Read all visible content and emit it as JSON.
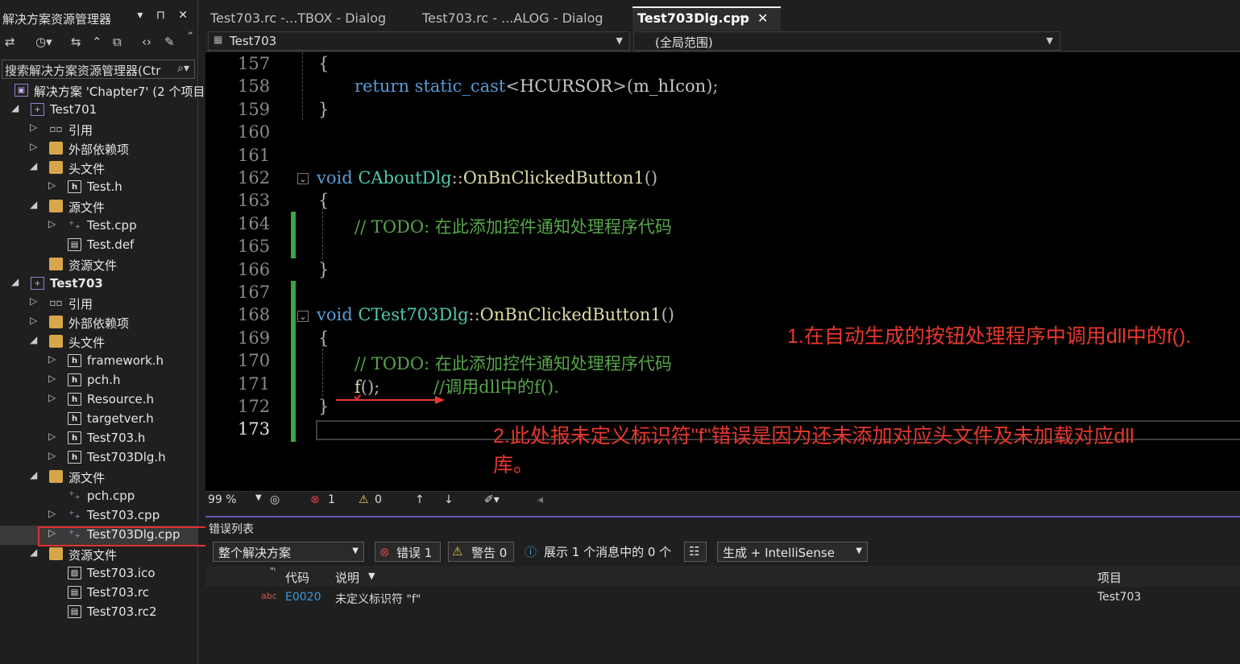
{
  "solution_explorer": {
    "title": "解决方案资源管理器",
    "title_controls": "▾ ⊓ ✕",
    "search_placeholder": "搜索解决方案资源管理器(Ctr",
    "tree": [
      {
        "name": "solution",
        "label": "解决方案 'Chapter7' (2 个项目",
        "icon": "solution-icon",
        "arrow": ""
      },
      {
        "name": "project-test701",
        "label": "Test701",
        "icon": "project-icon",
        "arrow": "◢"
      },
      {
        "name": "folder-references",
        "label": "引用",
        "icon": "references-icon",
        "arrow": "▷"
      },
      {
        "name": "folder-external",
        "label": "外部依赖项",
        "icon": "folder-icon",
        "arrow": "▷"
      },
      {
        "name": "folder-headers",
        "label": "头文件",
        "icon": "folder-icon",
        "arrow": "◢"
      },
      {
        "name": "file",
        "label": "Test.h",
        "icon": "header-file-icon",
        "arrow": "▷"
      },
      {
        "name": "folder-sources",
        "label": "源文件",
        "icon": "folder-icon",
        "arrow": "◢"
      },
      {
        "name": "file",
        "label": "Test.cpp",
        "icon": "cpp-file-icon",
        "arrow": "▷"
      },
      {
        "name": "file",
        "label": "Test.def",
        "icon": "def-file-icon",
        "arrow": ""
      },
      {
        "name": "folder-resources",
        "label": "资源文件",
        "icon": "folder-icon",
        "arrow": ""
      },
      {
        "name": "project-test703",
        "label": "Test703",
        "icon": "project-icon",
        "arrow": "◢",
        "bold": true
      },
      {
        "name": "folder-references",
        "label": "引用",
        "icon": "references-icon",
        "arrow": "▷"
      },
      {
        "name": "folder-external",
        "label": "外部依赖项",
        "icon": "folder-icon",
        "arrow": "▷"
      },
      {
        "name": "folder-headers",
        "label": "头文件",
        "icon": "folder-icon",
        "arrow": "◢"
      },
      {
        "name": "file",
        "label": "framework.h",
        "icon": "header-file-icon",
        "arrow": "▷"
      },
      {
        "name": "file",
        "label": "pch.h",
        "icon": "header-file-icon",
        "arrow": "▷"
      },
      {
        "name": "file",
        "label": "Resource.h",
        "icon": "header-file-icon",
        "arrow": "▷"
      },
      {
        "name": "file",
        "label": "targetver.h",
        "icon": "header-file-icon",
        "arrow": ""
      },
      {
        "name": "file",
        "label": "Test703.h",
        "icon": "header-file-icon",
        "arrow": "▷"
      },
      {
        "name": "file",
        "label": "Test703Dlg.h",
        "icon": "header-file-icon",
        "arrow": "▷"
      },
      {
        "name": "folder-sources",
        "label": "源文件",
        "icon": "folder-icon",
        "arrow": "◢"
      },
      {
        "name": "file",
        "label": "pch.cpp",
        "icon": "cpp-file-icon",
        "arrow": ""
      },
      {
        "name": "file",
        "label": "Test703.cpp",
        "icon": "cpp-file-icon",
        "arrow": "▷"
      },
      {
        "name": "file-selected",
        "label": "Test703Dlg.cpp",
        "icon": "cpp-file-icon",
        "arrow": "▷"
      },
      {
        "name": "folder-resources",
        "label": "资源文件",
        "icon": "folder-icon",
        "arrow": "◢"
      },
      {
        "name": "file",
        "label": "Test703.ico",
        "icon": "image-file-icon",
        "arrow": ""
      },
      {
        "name": "file",
        "label": "Test703.rc",
        "icon": "rc-file-icon",
        "arrow": ""
      },
      {
        "name": "file",
        "label": "Test703.rc2",
        "icon": "rc-file-icon",
        "arrow": ""
      }
    ]
  },
  "tabs": [
    {
      "label": "Test703.rc -...TBOX - Dialog"
    },
    {
      "label": "Test703.rc - ...ALOG - Dialog"
    },
    {
      "label": "Test703Dlg.cpp",
      "pin": "⊸",
      "close": "✕"
    }
  ],
  "nav": {
    "project": "Test703",
    "scope": "(全局范围)"
  },
  "editor": {
    "lines": [
      {
        "n": "157",
        "t": [
          [
            "pu",
            "{"
          ]
        ]
      },
      {
        "n": "158",
        "t": [
          [
            "kw",
            "return "
          ],
          [
            "kw",
            "static_cast"
          ],
          [
            "pu",
            "<"
          ],
          [
            "mac",
            "HCURSOR"
          ],
          [
            "pu",
            ">("
          ],
          [
            "mac",
            "m_hIcon"
          ],
          [
            "pu",
            ");"
          ]
        ]
      },
      {
        "n": "159",
        "t": [
          [
            "pu",
            "}"
          ]
        ]
      },
      {
        "n": "160",
        "t": []
      },
      {
        "n": "161",
        "t": []
      },
      {
        "n": "162",
        "t": [
          [
            "kw",
            "void "
          ],
          [
            "ty",
            "CAboutDlg"
          ],
          [
            "pu",
            "::"
          ],
          [
            "fn",
            "OnBnClickedButton1"
          ],
          [
            "pu",
            "()"
          ]
        ]
      },
      {
        "n": "163",
        "t": [
          [
            "pu",
            "{"
          ]
        ]
      },
      {
        "n": "164",
        "t": [
          [
            "cm",
            "// TODO: 在此添加控件通知处理程序代码"
          ]
        ]
      },
      {
        "n": "165",
        "t": []
      },
      {
        "n": "166",
        "t": [
          [
            "pu",
            "}"
          ]
        ]
      },
      {
        "n": "167",
        "t": []
      },
      {
        "n": "168",
        "t": [
          [
            "kw",
            "void "
          ],
          [
            "ty",
            "CTest703Dlg"
          ],
          [
            "pu",
            "::"
          ],
          [
            "fn",
            "OnBnClickedButton1"
          ],
          [
            "pu",
            "()"
          ]
        ]
      },
      {
        "n": "169",
        "t": [
          [
            "pu",
            "{"
          ]
        ]
      },
      {
        "n": "170",
        "t": [
          [
            "cm",
            "// TODO: 在此添加控件通知处理程序代码"
          ]
        ]
      },
      {
        "n": "171",
        "t": [
          [
            "fn",
            "f"
          ],
          [
            "pu",
            "();"
          ],
          [
            "pu",
            "          "
          ],
          [
            "cm",
            "//调用dll中的f()."
          ]
        ]
      },
      {
        "n": "172",
        "t": [
          [
            "pu",
            "}"
          ]
        ]
      },
      {
        "n": "173",
        "t": []
      }
    ],
    "annotation_1": "1.在自动生成的按钮处理程序中调用dll中的f().",
    "annotation_2a": "2.此处报未定义标识符\"f\"错误是因为还未添加对应头文件及未加载对应dll",
    "annotation_2b": "库。"
  },
  "status": {
    "zoom": "99 %",
    "errors": "1",
    "warnings": "0"
  },
  "error_list": {
    "title": "错误列表",
    "scope": "整个解决方案",
    "errors_btn": "错误 1",
    "warnings_btn": "警告 0",
    "messages": "展示 1 个消息中的 0 个",
    "filter": "生成 + IntelliSense",
    "columns": {
      "code": "代码",
      "desc": "说明",
      "project": "项目"
    },
    "row": {
      "code": "E0020",
      "desc": "未定义标识符 \"f\"",
      "project": "Test703"
    }
  },
  "colors": {
    "accent": "#6a53b8",
    "annotation": "#e8382c",
    "change_bar": "#3fa63f",
    "selection_box": "#e03030"
  }
}
